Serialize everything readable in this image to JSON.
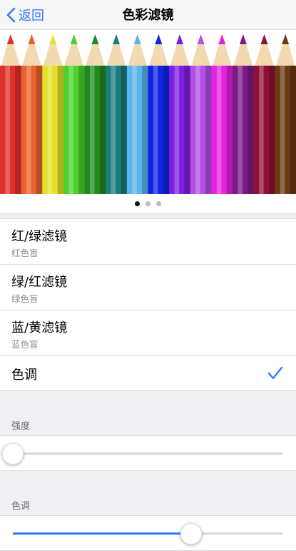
{
  "nav": {
    "back_label": "返回",
    "title": "色彩滤镜"
  },
  "pager": {
    "page_count": 3,
    "current": 1
  },
  "filters": [
    {
      "title": "红/绿滤镜",
      "subtitle": "红色盲",
      "selected": false
    },
    {
      "title": "绿/红滤镜",
      "subtitle": "绿色盲",
      "selected": false
    },
    {
      "title": "蓝/黄滤镜",
      "subtitle": "蓝色盲",
      "selected": false
    },
    {
      "title": "色调",
      "subtitle": "",
      "selected": true
    }
  ],
  "intensity": {
    "label": "强度",
    "value": 0.0
  },
  "hue": {
    "label": "色调",
    "value": 0.66
  },
  "colors": {
    "accent": "#2f7cf6",
    "pencils": [
      "#e0302b",
      "#e8632b",
      "#e4df2a",
      "#4cd12e",
      "#1f8a1e",
      "#1d7d7b",
      "#5bb5e8",
      "#1024e6",
      "#7b1fe0",
      "#b34fe6",
      "#e522e0",
      "#7a1b86",
      "#8e1038",
      "#6a3a12"
    ]
  }
}
